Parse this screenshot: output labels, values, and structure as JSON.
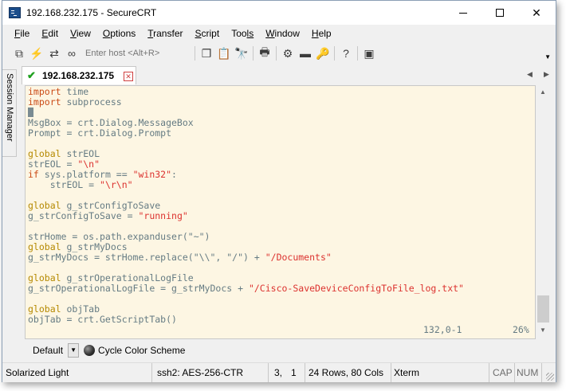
{
  "window": {
    "title": "192.168.232.175 - SecureCRT"
  },
  "menu": [
    {
      "mn": "F",
      "rest": "ile"
    },
    {
      "mn": "E",
      "rest": "dit"
    },
    {
      "mn": "V",
      "rest": "iew"
    },
    {
      "mn": "O",
      "rest": "ptions"
    },
    {
      "mn": "T",
      "rest": "ransfer"
    },
    {
      "mn": "S",
      "rest": "cript"
    },
    {
      "mn": "Too",
      "rest": "ls"
    },
    {
      "mn": "W",
      "rest": "indow"
    },
    {
      "mn": "H",
      "rest": "elp"
    }
  ],
  "toolbar": {
    "host_placeholder": "Enter host <Alt+R>",
    "icons": [
      "connect-icon",
      "quick-connect-icon",
      "reconnect-icon",
      "disconnect-icon",
      "copy-icon",
      "paste-icon",
      "find-icon",
      "print-icon",
      "settings-icon",
      "keymap-icon",
      "sftp-icon",
      "help-icon",
      "screenshot-icon"
    ]
  },
  "session_manager": {
    "label": "Session Manager"
  },
  "tab": {
    "label": "192.168.232.175",
    "status_color": "#1fa01f"
  },
  "terminal": {
    "colors": {
      "background": "#fdf6e3",
      "text": "#657b83",
      "keyword": "#b58900",
      "import": "#cb4b16",
      "string": "#dc322f"
    },
    "lines": [
      [
        {
          "t": "import",
          "c": "kw"
        },
        {
          "t": " time"
        }
      ],
      [
        {
          "t": "import",
          "c": "kw"
        },
        {
          "t": " subprocess"
        }
      ],
      [
        {
          "t": "",
          "c": "cursor"
        }
      ],
      [
        {
          "t": "MsgBox = crt.Dialog.MessageBox"
        }
      ],
      [
        {
          "t": "Prompt = crt.Dialog.Prompt"
        }
      ],
      [],
      [
        {
          "t": "global",
          "c": "k"
        },
        {
          "t": " strEOL"
        }
      ],
      [
        {
          "t": "strEOL = "
        },
        {
          "t": "\"\\n\"",
          "c": "s"
        }
      ],
      [
        {
          "t": "if",
          "c": "kw"
        },
        {
          "t": " sys.platform == "
        },
        {
          "t": "\"win32\"",
          "c": "s"
        },
        {
          "t": ":"
        }
      ],
      [
        {
          "t": "    strEOL = "
        },
        {
          "t": "\"\\r\\n\"",
          "c": "s"
        }
      ],
      [],
      [
        {
          "t": "global",
          "c": "k"
        },
        {
          "t": " g_strConfigToSave"
        }
      ],
      [
        {
          "t": "g_strConfigToSave = "
        },
        {
          "t": "\"running\"",
          "c": "s"
        }
      ],
      [],
      [
        {
          "t": "strHome = os.path.expanduser(\"~\")"
        }
      ],
      [
        {
          "t": "global",
          "c": "k"
        },
        {
          "t": " g_strMyDocs"
        }
      ],
      [
        {
          "t": "g_strMyDocs = strHome.replace(\"\\\\\", \"/\") + "
        },
        {
          "t": "\"/Documents\"",
          "c": "s"
        }
      ],
      [],
      [
        {
          "t": "global",
          "c": "k"
        },
        {
          "t": " g_strOperationalLogFile"
        }
      ],
      [
        {
          "t": "g_strOperationalLogFile = g_strMyDocs + "
        },
        {
          "t": "\"/Cisco-SaveDeviceConfigToFile_log.txt\"",
          "c": "s"
        }
      ],
      [],
      [
        {
          "t": "global",
          "c": "k"
        },
        {
          "t": " objTab"
        }
      ],
      [
        {
          "t": "objTab = crt.GetScriptTab()"
        }
      ]
    ],
    "position": "132,0-1",
    "percent": "26%"
  },
  "buttonbar": {
    "dropdown_label": "Default",
    "cycle_label": "Cycle Color Scheme"
  },
  "statusbar": {
    "scheme": "Solarized Light",
    "protocol": "ssh2: AES-256-CTR",
    "row": "3,",
    "col": "1",
    "size": "24 Rows, 80 Cols",
    "emulation": "Xterm",
    "cap": "CAP",
    "num": "NUM"
  }
}
